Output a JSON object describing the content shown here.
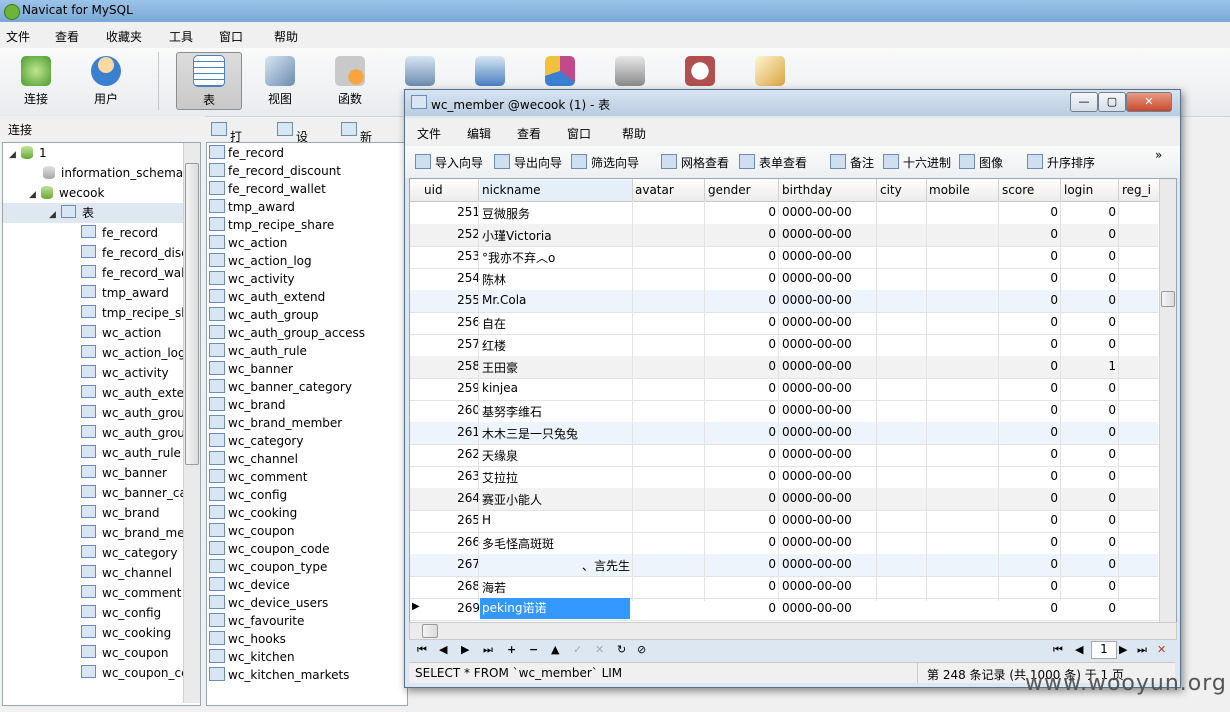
{
  "app": {
    "title": "Navicat for MySQL"
  },
  "menubar": [
    "文件",
    "查看",
    "收藏夹",
    "工具",
    "窗口",
    "帮助"
  ],
  "toolbar": [
    {
      "label": "连接",
      "icon": "connection-icon",
      "color": "#4a9a2e"
    },
    {
      "label": "用户",
      "icon": "user-icon",
      "color": "#e3a23a"
    },
    {
      "label": "表",
      "icon": "table-icon",
      "color": "#4a7fc0",
      "selected": true
    },
    {
      "label": "视图",
      "icon": "view-icon",
      "color": "#6b8bb0"
    },
    {
      "label": "函数",
      "icon": "function-icon",
      "color": "#e0862a"
    },
    {
      "label": "",
      "icon": "event-icon",
      "color": "#6b8bb0"
    },
    {
      "label": "",
      "icon": "query-icon",
      "color": "#4a7fc0"
    },
    {
      "label": "",
      "icon": "report-icon",
      "color": "#c04a8a"
    },
    {
      "label": "",
      "icon": "backup-icon",
      "color": "#666666"
    },
    {
      "label": "",
      "icon": "schedule-icon",
      "color": "#b05050"
    },
    {
      "label": "",
      "icon": "model-icon",
      "color": "#d9a441"
    }
  ],
  "left_panel": {
    "header": "连接",
    "tree": {
      "connection": "1",
      "databases": [
        "information_schema",
        "wecook"
      ],
      "tables_node": "表",
      "tables": [
        "fe_record",
        "fe_record_disc",
        "fe_record_wal",
        "tmp_award",
        "tmp_recipe_sh",
        "wc_action",
        "wc_action_log",
        "wc_activity",
        "wc_auth_exter",
        "wc_auth_grou",
        "wc_auth_grou",
        "wc_auth_rule",
        "wc_banner",
        "wc_banner_ca",
        "wc_brand",
        "wc_brand_me",
        "wc_category",
        "wc_channel",
        "wc_comment",
        "wc_config",
        "wc_cooking",
        "wc_coupon",
        "wc_coupon_cc"
      ]
    }
  },
  "object_toolbar": {
    "open": "打开表",
    "design": "设计表",
    "new": "新建表"
  },
  "object_list": [
    "fe_record",
    "fe_record_discount",
    "fe_record_wallet",
    "tmp_award",
    "tmp_recipe_share",
    "wc_action",
    "wc_action_log",
    "wc_activity",
    "wc_auth_extend",
    "wc_auth_group",
    "wc_auth_group_access",
    "wc_auth_rule",
    "wc_banner",
    "wc_banner_category",
    "wc_brand",
    "wc_brand_member",
    "wc_category",
    "wc_channel",
    "wc_comment",
    "wc_config",
    "wc_cooking",
    "wc_coupon",
    "wc_coupon_code",
    "wc_coupon_type",
    "wc_device",
    "wc_device_users",
    "wc_favourite",
    "wc_hooks",
    "wc_kitchen",
    "wc_kitchen_markets"
  ],
  "window": {
    "title": "wc_member @wecook (1) - 表",
    "menu": [
      "文件",
      "编辑",
      "查看",
      "窗口",
      "帮助"
    ],
    "toolbar": [
      "导入向导",
      "导出向导",
      "筛选向导",
      "网格查看",
      "表单查看",
      "备注",
      "十六进制",
      "图像",
      "升序排序"
    ],
    "columns": [
      "uid",
      "nickname",
      "avatar",
      "gender",
      "birthday",
      "city",
      "mobile",
      "score",
      "login",
      "reg_i"
    ],
    "rows": [
      {
        "uid": "251",
        "nickname": "豆微服务",
        "avatar": "",
        "gender": "0",
        "birthday": "0000-00-00",
        "city": "",
        "mobile": "",
        "score": "0",
        "login": "0"
      },
      {
        "uid": "252",
        "nickname": "小瑾Victoria",
        "avatar": "",
        "gender": "0",
        "birthday": "0000-00-00",
        "city": "",
        "mobile": "",
        "score": "0",
        "login": "0"
      },
      {
        "uid": "253",
        "nickname": "°我亦不弃︿o",
        "avatar": "",
        "gender": "0",
        "birthday": "0000-00-00",
        "city": "",
        "mobile": "",
        "score": "0",
        "login": "0"
      },
      {
        "uid": "254",
        "nickname": "陈林",
        "avatar": "",
        "gender": "0",
        "birthday": "0000-00-00",
        "city": "",
        "mobile": "",
        "score": "0",
        "login": "0"
      },
      {
        "uid": "255",
        "nickname": "Mr.Cola",
        "avatar": "",
        "gender": "0",
        "birthday": "0000-00-00",
        "city": "",
        "mobile": "",
        "score": "0",
        "login": "0"
      },
      {
        "uid": "256",
        "nickname": "自在",
        "avatar": "",
        "gender": "0",
        "birthday": "0000-00-00",
        "city": "",
        "mobile": "",
        "score": "0",
        "login": "0"
      },
      {
        "uid": "257",
        "nickname": "红楼",
        "avatar": "",
        "gender": "0",
        "birthday": "0000-00-00",
        "city": "",
        "mobile": "",
        "score": "0",
        "login": "0"
      },
      {
        "uid": "258",
        "nickname": "王田豪",
        "avatar": "",
        "gender": "0",
        "birthday": "0000-00-00",
        "city": "",
        "mobile": "",
        "score": "0",
        "login": "1"
      },
      {
        "uid": "259",
        "nickname": "kinjea",
        "avatar": "",
        "gender": "0",
        "birthday": "0000-00-00",
        "city": "",
        "mobile": "",
        "score": "0",
        "login": "0"
      },
      {
        "uid": "260",
        "nickname": "基努李维石",
        "avatar": "",
        "gender": "0",
        "birthday": "0000-00-00",
        "city": "",
        "mobile": "",
        "score": "0",
        "login": "0"
      },
      {
        "uid": "261",
        "nickname": "木木三是一只兔兔",
        "avatar": "",
        "gender": "0",
        "birthday": "0000-00-00",
        "city": "",
        "mobile": "",
        "score": "0",
        "login": "0"
      },
      {
        "uid": "262",
        "nickname": "天缘泉",
        "avatar": "",
        "gender": "0",
        "birthday": "0000-00-00",
        "city": "",
        "mobile": "",
        "score": "0",
        "login": "0"
      },
      {
        "uid": "263",
        "nickname": "艾拉拉",
        "avatar": "",
        "gender": "0",
        "birthday": "0000-00-00",
        "city": "",
        "mobile": "",
        "score": "0",
        "login": "0"
      },
      {
        "uid": "264",
        "nickname": "赛亚小能人",
        "avatar": "",
        "gender": "0",
        "birthday": "0000-00-00",
        "city": "",
        "mobile": "",
        "score": "0",
        "login": "0"
      },
      {
        "uid": "265",
        "nickname": "H",
        "avatar": "",
        "gender": "0",
        "birthday": "0000-00-00",
        "city": "",
        "mobile": "",
        "score": "0",
        "login": "0"
      },
      {
        "uid": "266",
        "nickname": "多毛怪高斑斑",
        "avatar": "",
        "gender": "0",
        "birthday": "0000-00-00",
        "city": "",
        "mobile": "",
        "score": "0",
        "login": "0"
      },
      {
        "uid": "267",
        "nickname": "、言先生",
        "avatar": "",
        "gender": "0",
        "birthday": "0000-00-00",
        "city": "",
        "mobile": "",
        "score": "0",
        "login": "0"
      },
      {
        "uid": "268",
        "nickname": "海若",
        "avatar": "",
        "gender": "0",
        "birthday": "0000-00-00",
        "city": "",
        "mobile": "",
        "score": "0",
        "login": "0"
      },
      {
        "uid": "269",
        "nickname": "peking诺诺",
        "avatar": "",
        "gender": "0",
        "birthday": "0000-00-00",
        "city": "",
        "mobile": "",
        "score": "0",
        "login": "0"
      }
    ],
    "page_input": "1",
    "status_sql": "SELECT * FROM `wc_member` LIM",
    "status_record": "第 248 条记录 (共 1000 条) 于 1 页"
  },
  "watermark": "www.wooyun.org",
  "colors": {
    "selection": "#3399ff",
    "title_gradient_top": "#9cc4e8",
    "window_border": "#59718b"
  }
}
